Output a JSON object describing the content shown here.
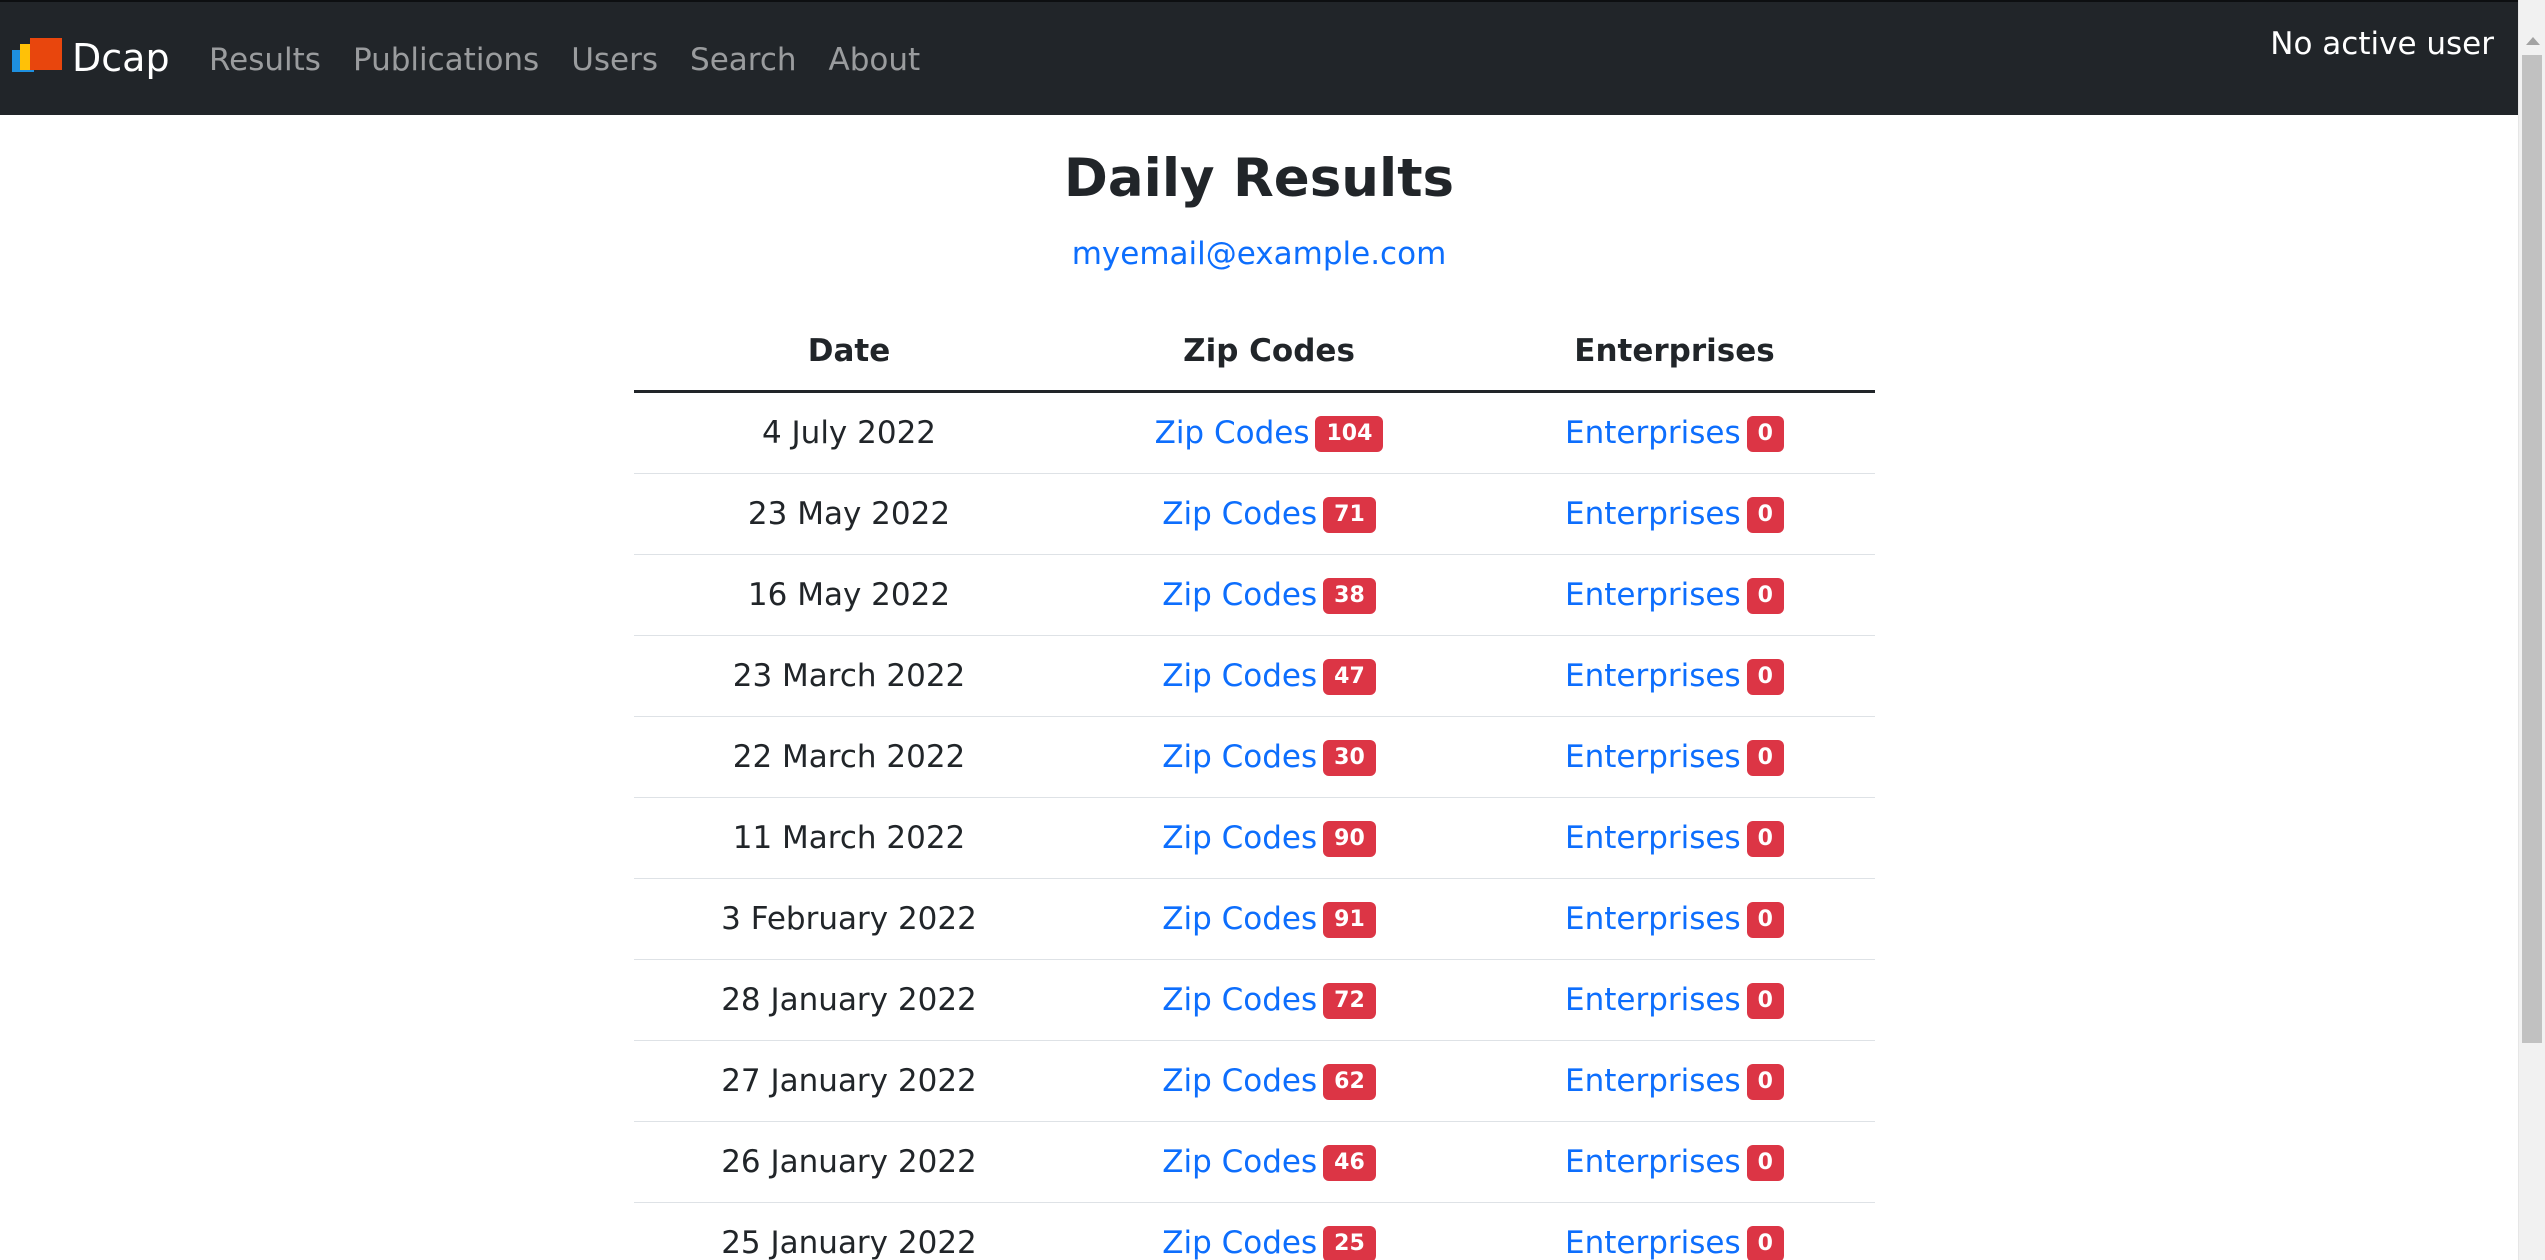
{
  "navbar": {
    "brand": "Dcap",
    "links": [
      "Results",
      "Publications",
      "Users",
      "Search",
      "About"
    ],
    "user_status": "No active user"
  },
  "main": {
    "title": "Daily Results",
    "email": "myemail@example.com"
  },
  "table": {
    "headers": [
      "Date",
      "Zip Codes",
      "Enterprises"
    ],
    "rows": [
      {
        "date": "4 July 2022",
        "zip_label": "Zip Codes",
        "zip_count": "104",
        "ent_label": "Enterprises",
        "ent_count": "0"
      },
      {
        "date": "23 May 2022",
        "zip_label": "Zip Codes",
        "zip_count": "71",
        "ent_label": "Enterprises",
        "ent_count": "0"
      },
      {
        "date": "16 May 2022",
        "zip_label": "Zip Codes",
        "zip_count": "38",
        "ent_label": "Enterprises",
        "ent_count": "0"
      },
      {
        "date": "23 March 2022",
        "zip_label": "Zip Codes",
        "zip_count": "47",
        "ent_label": "Enterprises",
        "ent_count": "0"
      },
      {
        "date": "22 March 2022",
        "zip_label": "Zip Codes",
        "zip_count": "30",
        "ent_label": "Enterprises",
        "ent_count": "0"
      },
      {
        "date": "11 March 2022",
        "zip_label": "Zip Codes",
        "zip_count": "90",
        "ent_label": "Enterprises",
        "ent_count": "0"
      },
      {
        "date": "3 February 2022",
        "zip_label": "Zip Codes",
        "zip_count": "91",
        "ent_label": "Enterprises",
        "ent_count": "0"
      },
      {
        "date": "28 January 2022",
        "zip_label": "Zip Codes",
        "zip_count": "72",
        "ent_label": "Enterprises",
        "ent_count": "0"
      },
      {
        "date": "27 January 2022",
        "zip_label": "Zip Codes",
        "zip_count": "62",
        "ent_label": "Enterprises",
        "ent_count": "0"
      },
      {
        "date": "26 January 2022",
        "zip_label": "Zip Codes",
        "zip_count": "46",
        "ent_label": "Enterprises",
        "ent_count": "0"
      },
      {
        "date": "25 January 2022",
        "zip_label": "Zip Codes",
        "zip_count": "25",
        "ent_label": "Enterprises",
        "ent_count": "0"
      }
    ]
  },
  "colors": {
    "navbar_bg": "#212529",
    "link": "#0d6efd",
    "badge": "#dc3545"
  },
  "icons": {
    "brand": "dcap-logo-icon"
  }
}
